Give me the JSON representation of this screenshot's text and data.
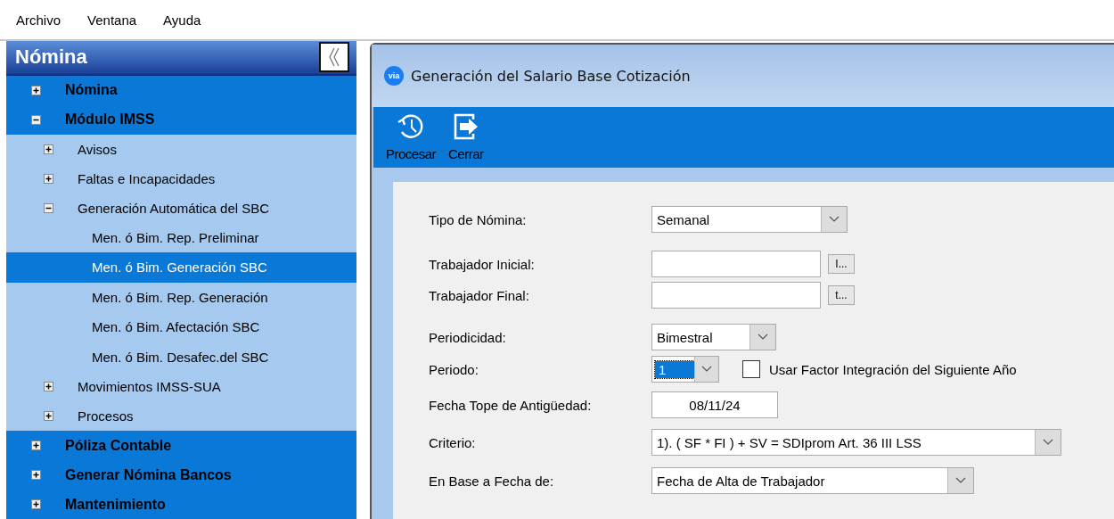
{
  "menu_bar": [
    "Archivo",
    "Ventana",
    "Ayuda"
  ],
  "sidebar": {
    "title": "Nómina",
    "items": [
      {
        "label": "Nómina",
        "expanded": false,
        "selected": false
      },
      {
        "label": "Módulo IMSS",
        "expanded": true,
        "selected": false,
        "children": [
          {
            "label": "Avisos",
            "expanded": false,
            "selected": false
          },
          {
            "label": "Faltas e Incapacidades",
            "expanded": false,
            "selected": false
          },
          {
            "label": "Generación Automática del SBC",
            "expanded": true,
            "selected": false,
            "children": [
              {
                "label": "Men. ó Bim. Rep. Preliminar",
                "selected": false
              },
              {
                "label": "Men. ó Bim. Generación SBC",
                "selected": true
              },
              {
                "label": "Men. ó Bim. Rep. Generación",
                "selected": false
              },
              {
                "label": "Men. ó Bim. Afectación SBC",
                "selected": false
              },
              {
                "label": "Men. ó Bim. Desafec.del SBC",
                "selected": false
              }
            ]
          },
          {
            "label": "Movimientos IMSS-SUA",
            "expanded": false,
            "selected": false
          },
          {
            "label": "Procesos",
            "expanded": false,
            "selected": false
          }
        ]
      },
      {
        "label": "Póliza Contable",
        "expanded": false,
        "selected": false
      },
      {
        "label": "Generar Nómina Bancos",
        "expanded": false,
        "selected": false
      },
      {
        "label": "Mantenimiento",
        "expanded": false,
        "selected": false
      }
    ]
  },
  "window": {
    "logo_text": "via",
    "title": "Generación del Salario Base Cotización"
  },
  "toolbar": [
    {
      "label": "Procesar",
      "kind": "history"
    },
    {
      "label": "Cerrar",
      "kind": "exit"
    }
  ],
  "form": [
    {
      "kind": "select",
      "label": "Tipo de Nómina:",
      "value": "Semanal"
    },
    {
      "kind": "lookup",
      "label": "Trabajador Inicial:",
      "button": "I..."
    },
    {
      "kind": "lookup",
      "label": "Trabajador Final:",
      "button": "t..."
    },
    {
      "kind": "select",
      "label": "Periodicidad:",
      "value": "Bimestral"
    },
    {
      "kind": "select",
      "label": "Periodo:",
      "value": "1",
      "focused": true,
      "checkbox": {
        "label": "Usar Factor Integración del Siguiente Año",
        "checked": false
      }
    },
    {
      "kind": "date",
      "label": "Fecha Tope de Antigüedad:",
      "value": "08/11/24"
    },
    {
      "kind": "select",
      "label": "Criterio:",
      "value": "1). ( SF *  FI  ) + SV = SDIprom Art. 36 III LSS"
    },
    {
      "kind": "select",
      "label": "En Base a Fecha de:",
      "value": "Fecha de Alta de Trabajador"
    }
  ]
}
